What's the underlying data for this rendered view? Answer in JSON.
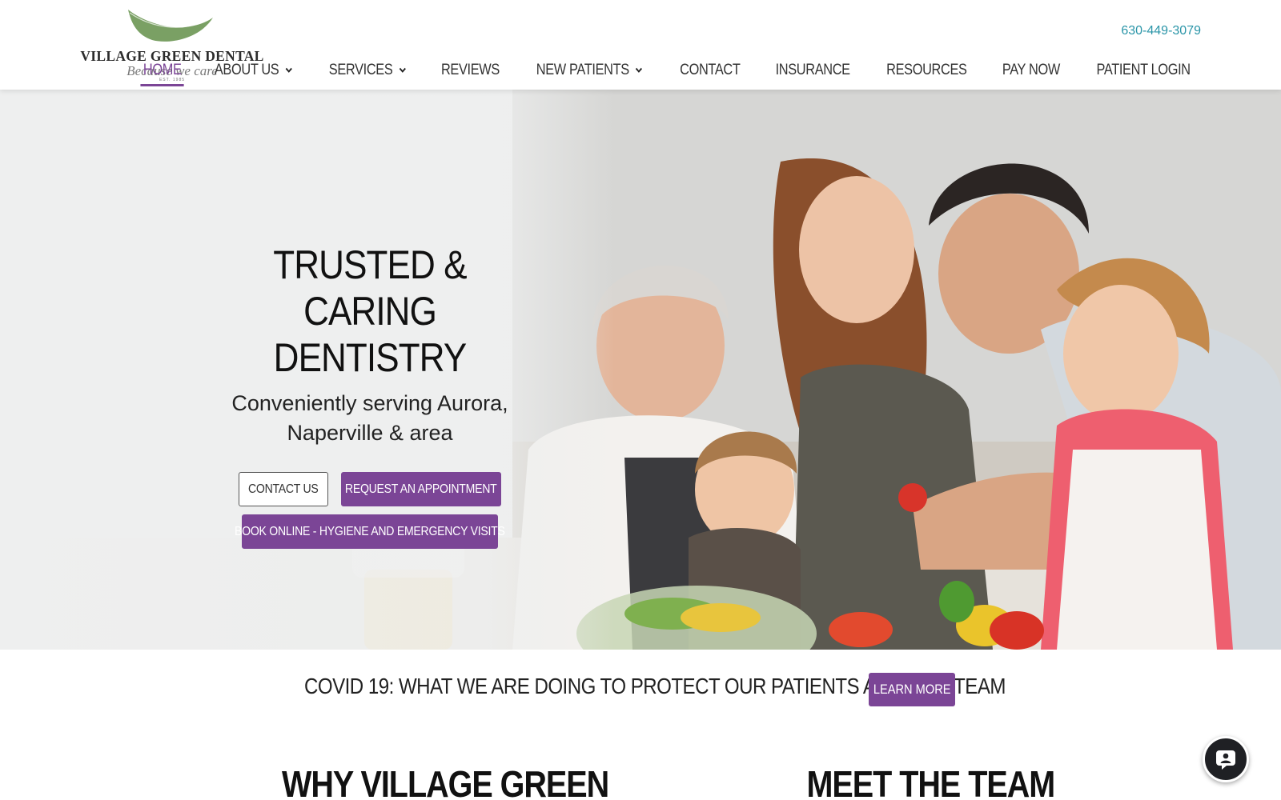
{
  "brand": {
    "name": "VILLAGE GREEN DENTAL",
    "tagline": "Because we care",
    "established": "EST. 1985",
    "leaf_color": "#7aa064"
  },
  "header": {
    "phone": "630-449-3079",
    "nav": [
      {
        "label": "HOME",
        "active": true,
        "dropdown": false
      },
      {
        "label": "ABOUT US",
        "active": false,
        "dropdown": true
      },
      {
        "label": "SERVICES",
        "active": false,
        "dropdown": true
      },
      {
        "label": "REVIEWS",
        "active": false,
        "dropdown": false
      },
      {
        "label": "NEW PATIENTS",
        "active": false,
        "dropdown": true
      },
      {
        "label": "CONTACT",
        "active": false,
        "dropdown": false
      },
      {
        "label": "INSURANCE",
        "active": false,
        "dropdown": false
      },
      {
        "label": "RESOURCES",
        "active": false,
        "dropdown": false
      },
      {
        "label": "PAY NOW",
        "active": false,
        "dropdown": false
      },
      {
        "label": "PATIENT LOGIN",
        "active": false,
        "dropdown": false
      }
    ]
  },
  "hero": {
    "title_line1": "TRUSTED & CARING",
    "title_line2": "DENTISTRY",
    "subtitle_line1": "Conveniently serving Aurora,",
    "subtitle_line2": "Naperville & area",
    "contact_button": "CONTACT US",
    "appointment_button": "REQUEST AN APPOINTMENT",
    "book_button": "BOOK ONLINE - HYGIENE AND EMERGENCY VISITS"
  },
  "covid": {
    "text": "COVID 19: WHAT WE ARE DOING TO PROTECT OUR PATIENTS AND OUR TEAM",
    "button": "LEARN MORE"
  },
  "sections": {
    "why": "WHY VILLAGE GREEN",
    "team": "MEET THE TEAM"
  },
  "colors": {
    "accent": "#7b4596",
    "phone": "#2a95a8",
    "chat": "#1f2024"
  },
  "icons": {
    "chevron": "chevron-down-icon",
    "chat": "chat-icon"
  }
}
